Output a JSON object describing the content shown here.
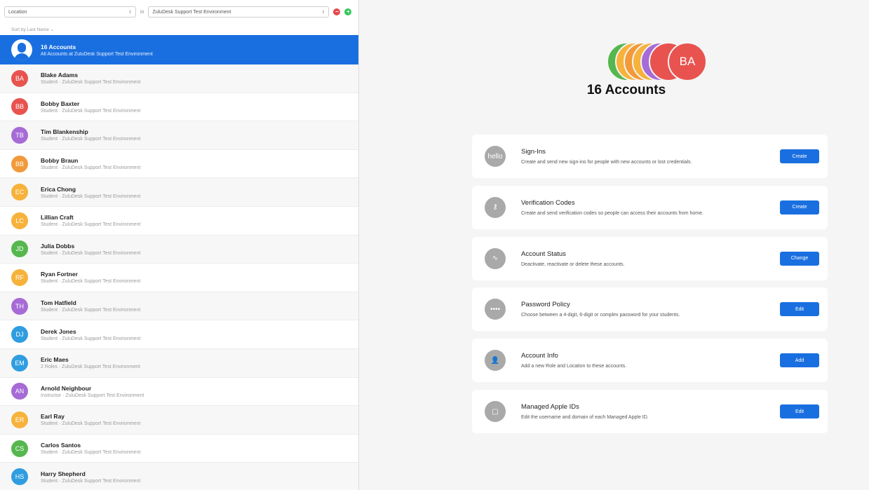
{
  "filter": {
    "location": "Location",
    "in_label": "in",
    "environment": "ZuluDesk Support Test Environment",
    "remove_glyph": "−",
    "add_glyph": "+"
  },
  "sort_label": "Sort by Last Name ⌄",
  "all_accounts": {
    "title": "16 Accounts",
    "subtitle": "All Accounts at ZuluDesk Support Test Environment"
  },
  "people": [
    {
      "initials": "BA",
      "name": "Blake Adams",
      "sub": "Student · ZuluDesk Support Test Environment",
      "color": "#e8534f"
    },
    {
      "initials": "BB",
      "name": "Bobby Baxter",
      "sub": "Student · ZuluDesk Support Test Environment",
      "color": "#e8534f"
    },
    {
      "initials": "TB",
      "name": "Tim Blankenship",
      "sub": "Student · ZuluDesk Support Test Environment",
      "color": "#a66bd6"
    },
    {
      "initials": "BB",
      "name": "Bobby Braun",
      "sub": "Student · ZuluDesk Support Test Environment",
      "color": "#f29a3a"
    },
    {
      "initials": "EC",
      "name": "Erica Chong",
      "sub": "Student · ZuluDesk Support Test Environment",
      "color": "#f7b23b"
    },
    {
      "initials": "LC",
      "name": "Lillian Craft",
      "sub": "Student · ZuluDesk Support Test Environment",
      "color": "#f7b23b"
    },
    {
      "initials": "JD",
      "name": "Julia Dobbs",
      "sub": "Student · ZuluDesk Support Test Environment",
      "color": "#55b74e"
    },
    {
      "initials": "RF",
      "name": "Ryan Fortner",
      "sub": "Student · ZuluDesk Support Test Environment",
      "color": "#f7b23b"
    },
    {
      "initials": "TH",
      "name": "Tom Hatfield",
      "sub": "Student · ZuluDesk Support Test Environment",
      "color": "#a66bd6"
    },
    {
      "initials": "DJ",
      "name": "Derek Jones",
      "sub": "Student · ZuluDesk Support Test Environment",
      "color": "#2f9de0"
    },
    {
      "initials": "EM",
      "name": "Eric Maes",
      "sub": "2 Roles · ZuluDesk Support Test Environment",
      "color": "#2f9de0"
    },
    {
      "initials": "AN",
      "name": "Arnold Neighbour",
      "sub": "Instructor · ZuluDesk Support Test Environment",
      "color": "#a66bd6"
    },
    {
      "initials": "ER",
      "name": "Earl Ray",
      "sub": "Student · ZuluDesk Support Test Environment",
      "color": "#f7b23b"
    },
    {
      "initials": "CS",
      "name": "Carlos Santos",
      "sub": "Student · ZuluDesk Support Test Environment",
      "color": "#55b74e"
    },
    {
      "initials": "HS",
      "name": "Harry Shepherd",
      "sub": "Student · ZuluDesk Support Test Environment",
      "color": "#2f9de0"
    }
  ],
  "summary": {
    "stack_colors": [
      "#55b74e",
      "#f7b23b",
      "#f29a3a",
      "#f7b23b",
      "#a66bd6",
      "#e8534f"
    ],
    "stack_label": "BA",
    "title": "16 Accounts"
  },
  "cards": [
    {
      "title": "Sign-Ins",
      "desc": "Create and send new sign-ins for people with new accounts or lost credentials.",
      "button": "Create",
      "icon": "hello-icon",
      "glyph": "hello"
    },
    {
      "title": "Verification Codes",
      "desc": "Create and send verification codes so people can access their accounts from home.",
      "button": "Create",
      "icon": "key-icon",
      "glyph": "⚷"
    },
    {
      "title": "Account Status",
      "desc": "Deactivate, reactivate or delete these accounts.",
      "button": "Change",
      "icon": "activity-icon",
      "glyph": "∿"
    },
    {
      "title": "Password Policy",
      "desc": "Choose between a 4-digit, 6-digit or complex password for your students.",
      "button": "Edit",
      "icon": "password-dots-icon",
      "glyph": "••••"
    },
    {
      "title": "Account Info",
      "desc": "Add a new Role and Location to these accounts.",
      "button": "Add",
      "icon": "person-icon",
      "glyph": "👤"
    },
    {
      "title": "Managed Apple IDs",
      "desc": "Edit the username and domain of each Managed Apple ID.",
      "button": "Edit",
      "icon": "apple-id-icon",
      "glyph": "▢"
    }
  ]
}
